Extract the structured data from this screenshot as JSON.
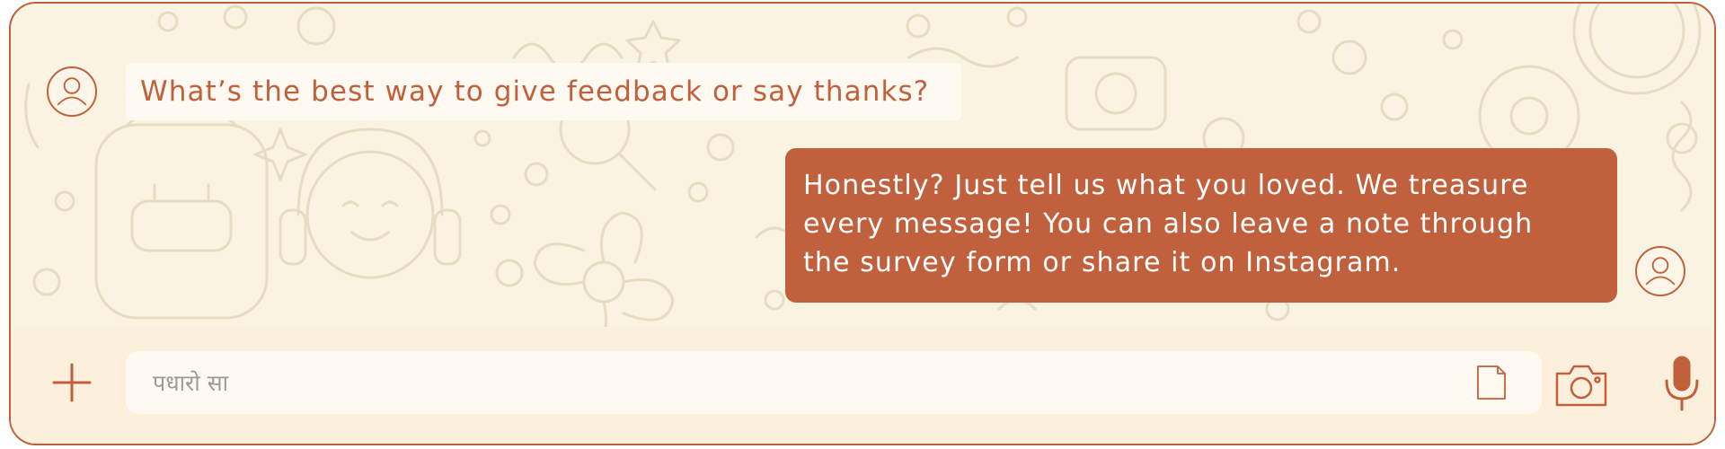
{
  "messages": [
    {
      "direction": "incoming",
      "text": "What’s the best way to give feedback or say thanks?"
    },
    {
      "direction": "outgoing",
      "lines": [
        "Honestly? Just tell us what you loved. We treasure",
        "every message! You can also leave a note through",
        "the survey form or share it on Instagram."
      ]
    }
  ],
  "composer": {
    "placeholder": "पधारो सा",
    "value": ""
  },
  "icons": {
    "add": "plus-icon",
    "attach_document": "document-icon",
    "camera": "camera-icon",
    "voice": "microphone-icon",
    "avatar": "user-avatar-icon",
    "background": "doodle-pattern"
  },
  "colors": {
    "accent": "#c0603d",
    "chat_background": "#fbf3e1",
    "doodle_stroke": "#e6dcc4",
    "incoming_bubble": "#fefaf1",
    "composer_bar": "#fcf0dd",
    "input_background": "#fefaf2",
    "placeholder_text": "#9a9a9a"
  }
}
